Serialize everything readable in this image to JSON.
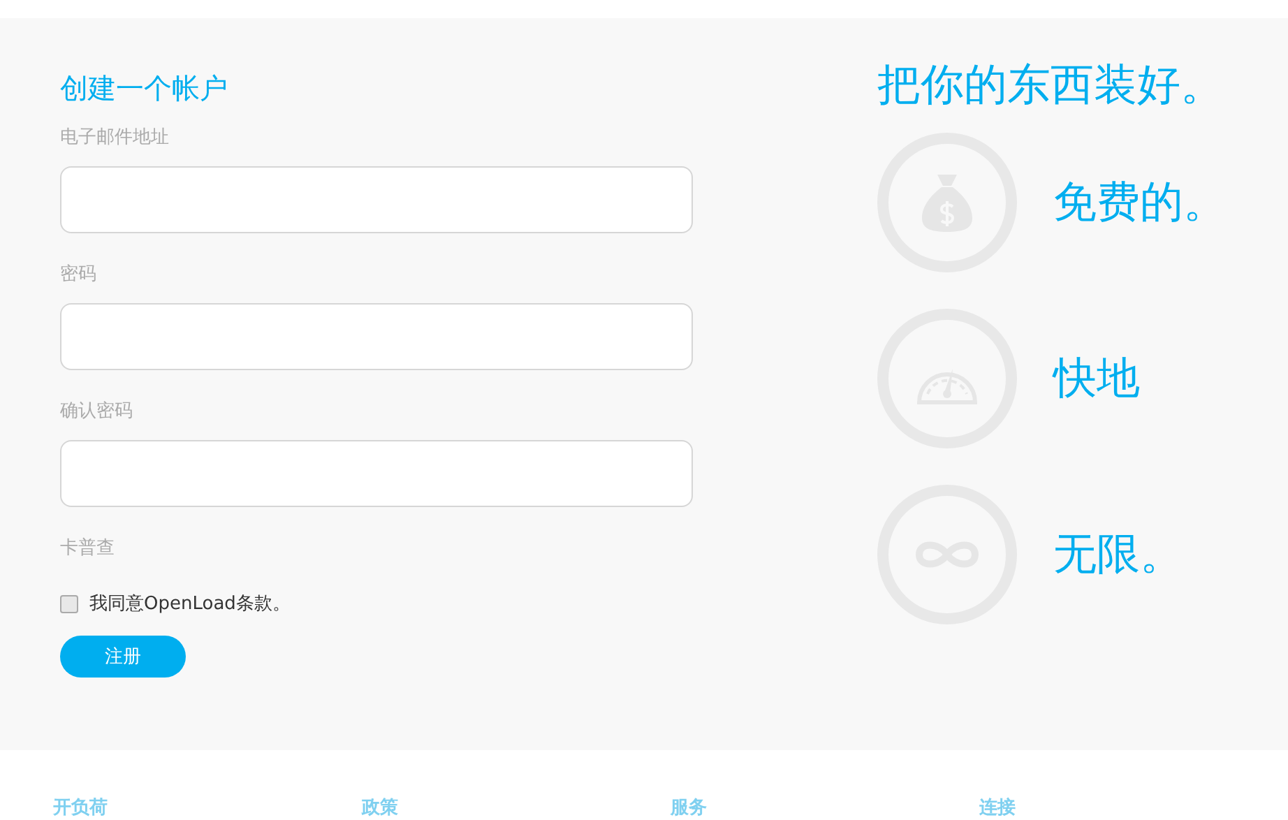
{
  "form": {
    "title": "创建一个帐户",
    "fields": [
      {
        "label": "电子邮件地址"
      },
      {
        "label": "密码"
      },
      {
        "label": "确认密码"
      }
    ],
    "captcha_label": "卡普查",
    "terms": {
      "label": "我同意OpenLoad条款。",
      "checked": false
    },
    "submit": "注册"
  },
  "features": {
    "heading": "把你的东西装好。",
    "items": [
      {
        "kind": "money",
        "label": "免费的。"
      },
      {
        "kind": "speed",
        "label": "快地"
      },
      {
        "kind": "infinity",
        "label": "无限。"
      }
    ]
  },
  "footer": {
    "columns": [
      "开负荷",
      "政策",
      "服务",
      "连接"
    ]
  }
}
